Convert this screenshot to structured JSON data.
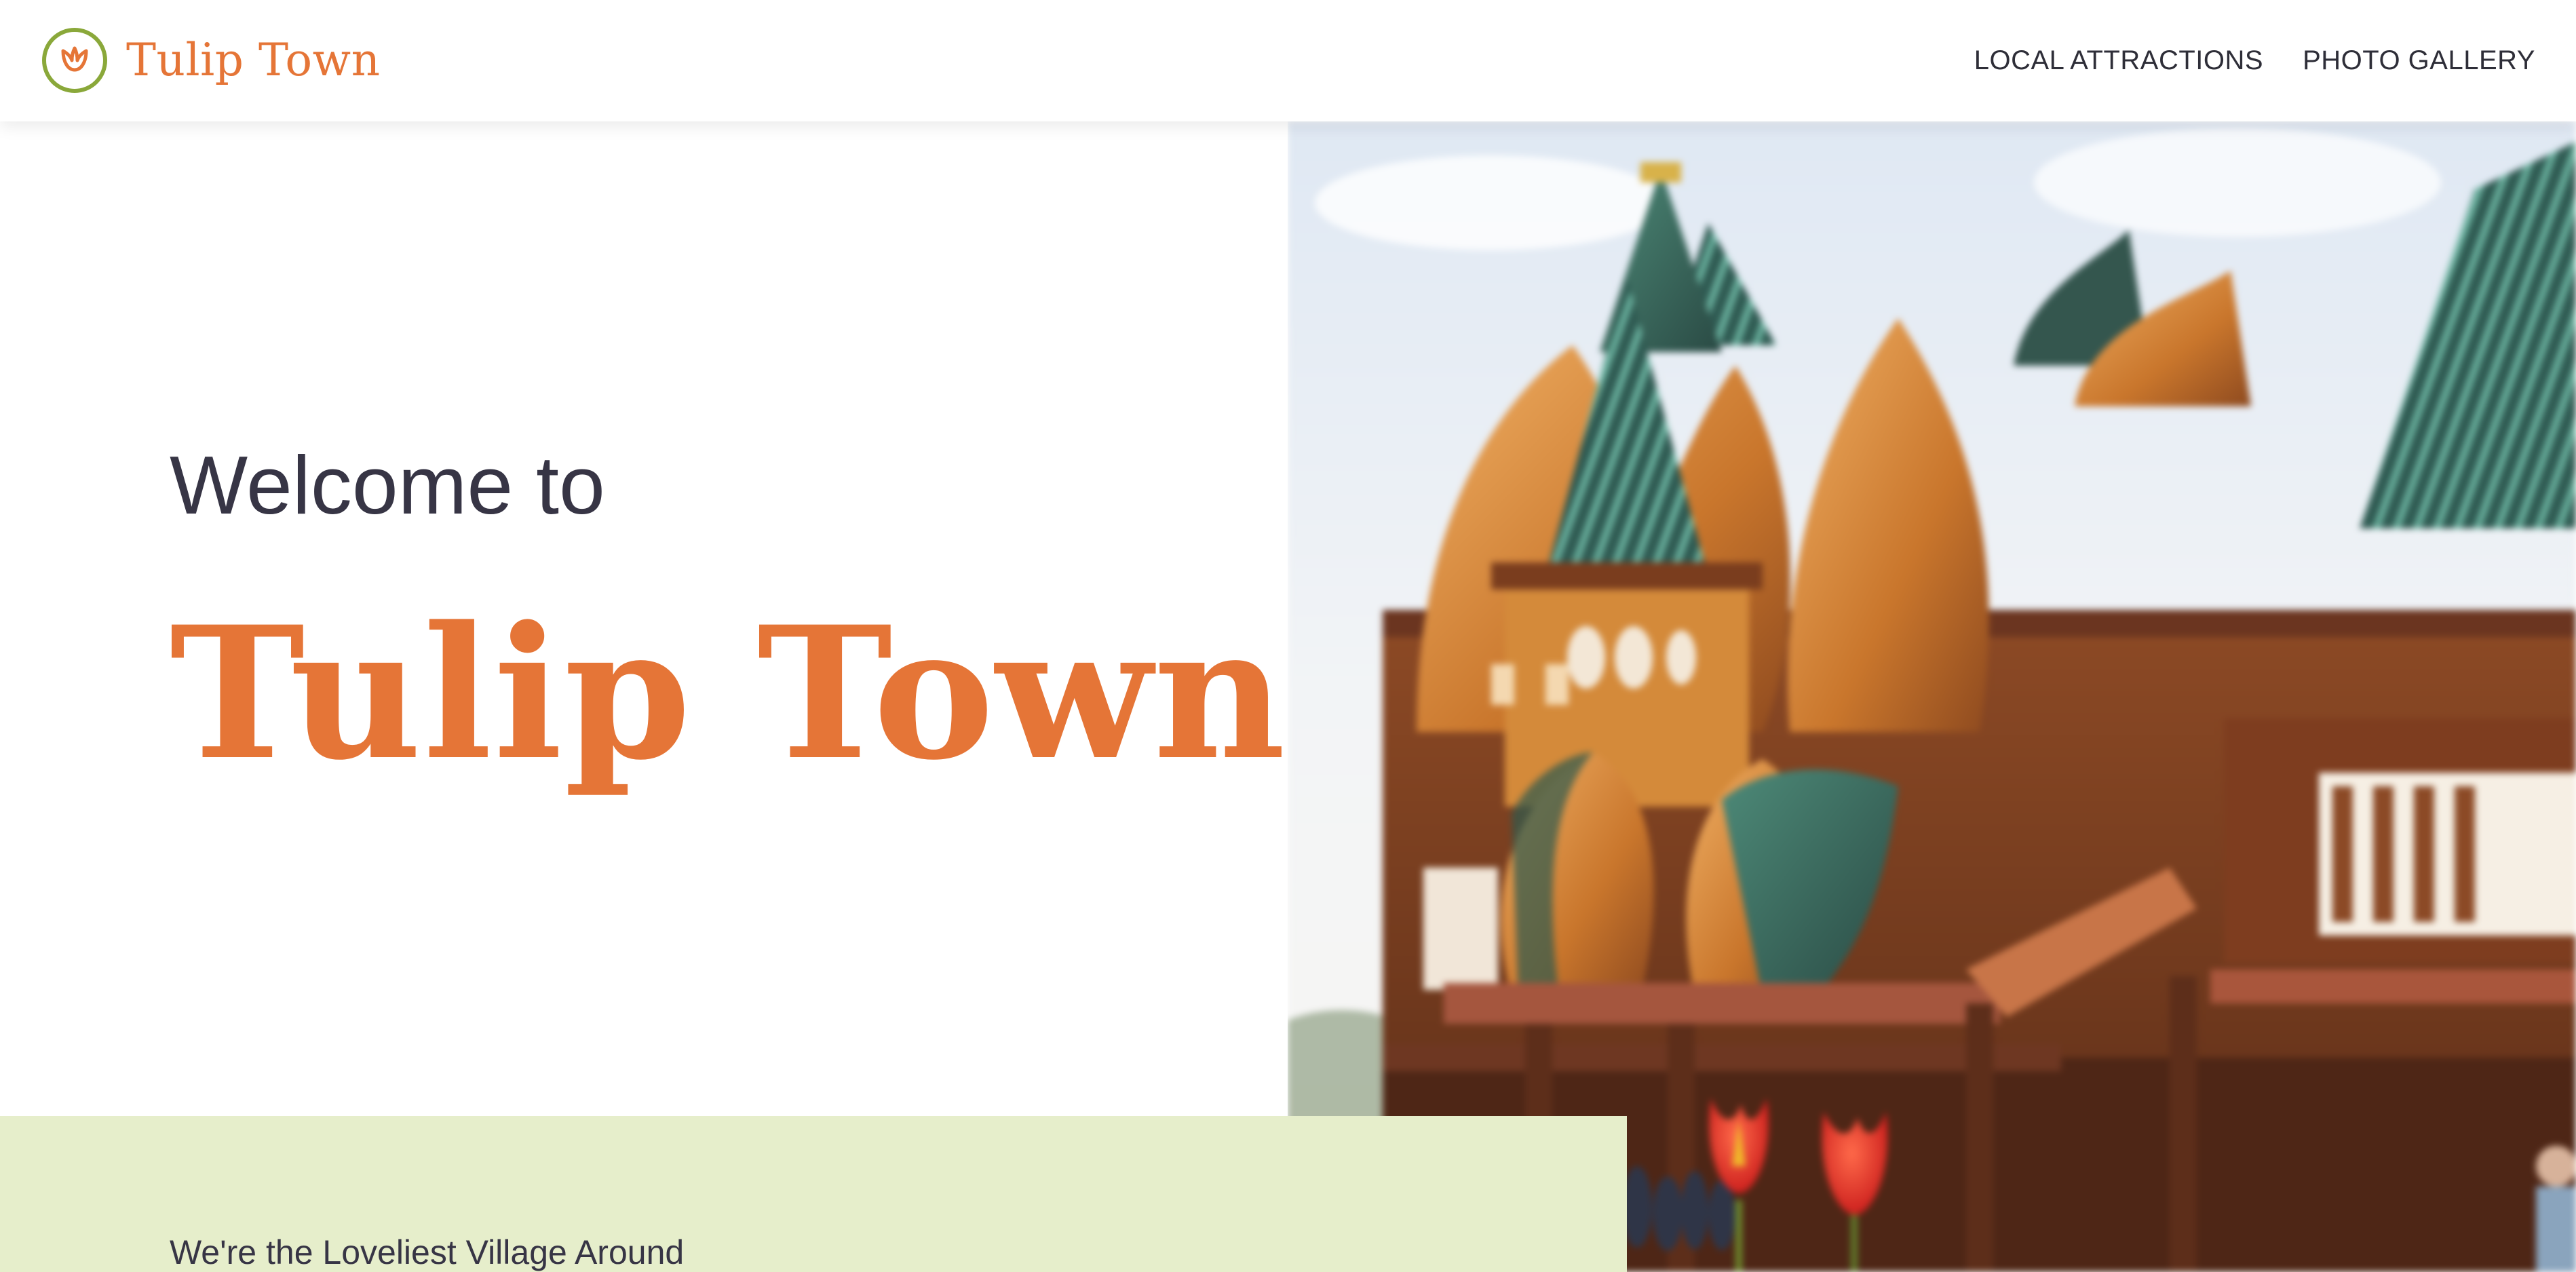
{
  "header": {
    "brand_name": "Tulip Town",
    "logo_icon": "tulip-icon",
    "nav": [
      {
        "label": "LOCAL ATTRACTIONS"
      },
      {
        "label": "PHOTO GALLERY"
      }
    ]
  },
  "hero": {
    "welcome": "Welcome to",
    "title": "Tulip Town",
    "image_subject": "wooden palace with onion domes and red tulips"
  },
  "intro": {
    "heading": "We're the Loveliest Village Around"
  },
  "colors": {
    "brand_orange": "#e57537",
    "logo_green": "#8aa83a",
    "text_dark": "#373545",
    "band_green": "#e6eecb"
  }
}
